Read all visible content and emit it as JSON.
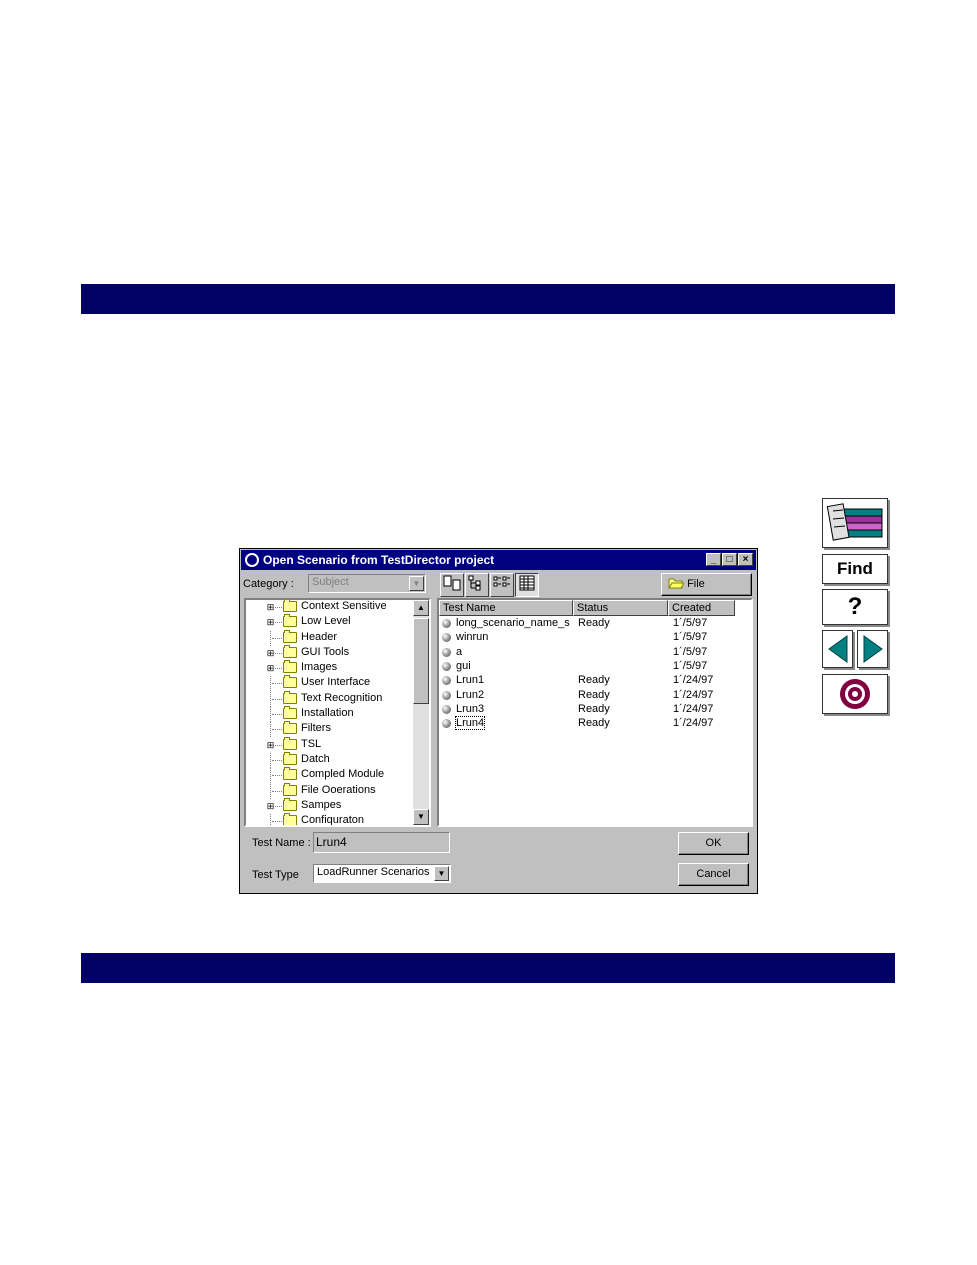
{
  "dialog": {
    "title": "Open  Scenario from TestDirector project",
    "window_buttons": {
      "minimize": "_",
      "maximize": "□",
      "close": "×"
    },
    "category_label": "Category :",
    "category_value": "Subject",
    "file_system_label": "File System...",
    "tree_items": [
      {
        "label": "Context Sensitive",
        "expandable": true
      },
      {
        "label": "Low Level",
        "expandable": true
      },
      {
        "label": "Header",
        "expandable": false
      },
      {
        "label": "GUI Tools",
        "expandable": true
      },
      {
        "label": "Images",
        "expandable": true
      },
      {
        "label": "User Interface",
        "expandable": false
      },
      {
        "label": "Text Recognition",
        "expandable": false
      },
      {
        "label": "Installation",
        "expandable": false
      },
      {
        "label": "Filters",
        "expandable": false
      },
      {
        "label": "TSL",
        "expandable": true
      },
      {
        "label": "Datch",
        "expandable": false
      },
      {
        "label": "Compled Module",
        "expandable": false
      },
      {
        "label": "File Ooerations",
        "expandable": false
      },
      {
        "label": "Sampes",
        "expandable": true
      },
      {
        "label": "Confiquraton",
        "expandable": false
      }
    ],
    "columns": {
      "name": "Test Name",
      "status": "Status",
      "created": "Created"
    },
    "tests": [
      {
        "name": "long_scenario_name_s",
        "status": "Ready",
        "created": "1´/5/97"
      },
      {
        "name": "winrun",
        "status": "",
        "created": "1´/5/97"
      },
      {
        "name": "a",
        "status": "",
        "created": "1´/5/97"
      },
      {
        "name": "gui",
        "status": "",
        "created": "1´/5/97"
      },
      {
        "name": "Lrun1",
        "status": "Ready",
        "created": "1´/24/97"
      },
      {
        "name": "Lrun2",
        "status": "Ready",
        "created": "1´/24/97"
      },
      {
        "name": "Lrun3",
        "status": "Ready",
        "created": "1´/24/97"
      },
      {
        "name": "Lrun4",
        "status": "Ready",
        "created": "1´/24/97"
      }
    ],
    "selected_test": "Lrun4",
    "test_name_label": "Test Name :",
    "test_name_value": "Lrun4",
    "test_type_label": "Test Type",
    "test_type_value": "LoadRunner Scenarios",
    "ok_label": "OK",
    "cancel_label": "Cancel"
  },
  "nav": {
    "find_label": "Find",
    "help_label": "?",
    "icons": [
      "books-icon",
      "prev-arrow-icon",
      "next-arrow-icon",
      "home-target-icon"
    ]
  },
  "colors": {
    "header_bar": "#000066",
    "title_bar": "#000080",
    "nav_teal": "#008080",
    "nav_maroon": "#800040"
  }
}
